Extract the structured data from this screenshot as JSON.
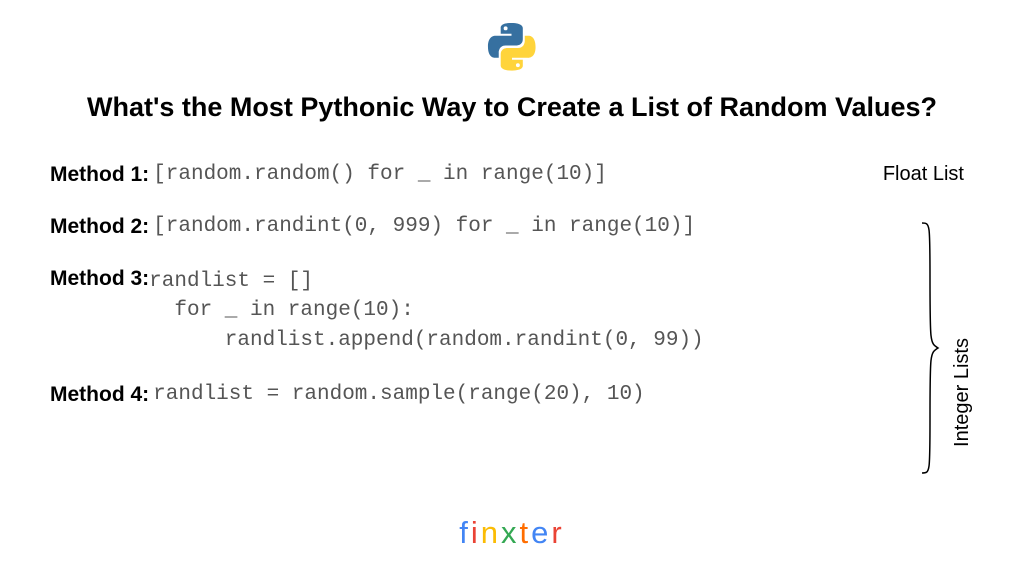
{
  "title": "What's the Most Pythonic Way to Create a List of Random Values?",
  "methods": [
    {
      "label": "Method 1",
      "code": "[random.random() for _ in range(10)]"
    },
    {
      "label": "Method 2",
      "code": "[random.randint(0, 999) for _ in range(10)]"
    },
    {
      "label": "Method 3",
      "lines": [
        "randlist = []",
        "  for _ in range(10):",
        "      randlist.append(random.randint(0, 99))"
      ]
    },
    {
      "label": "Method 4",
      "code": "randlist = random.sample(range(20), 10)"
    }
  ],
  "annotations": {
    "float_list": "Float List",
    "integer_lists": "Integer Lists"
  },
  "footer": {
    "chars": [
      "f",
      "i",
      "n",
      "x",
      "t",
      "e",
      "r"
    ]
  }
}
